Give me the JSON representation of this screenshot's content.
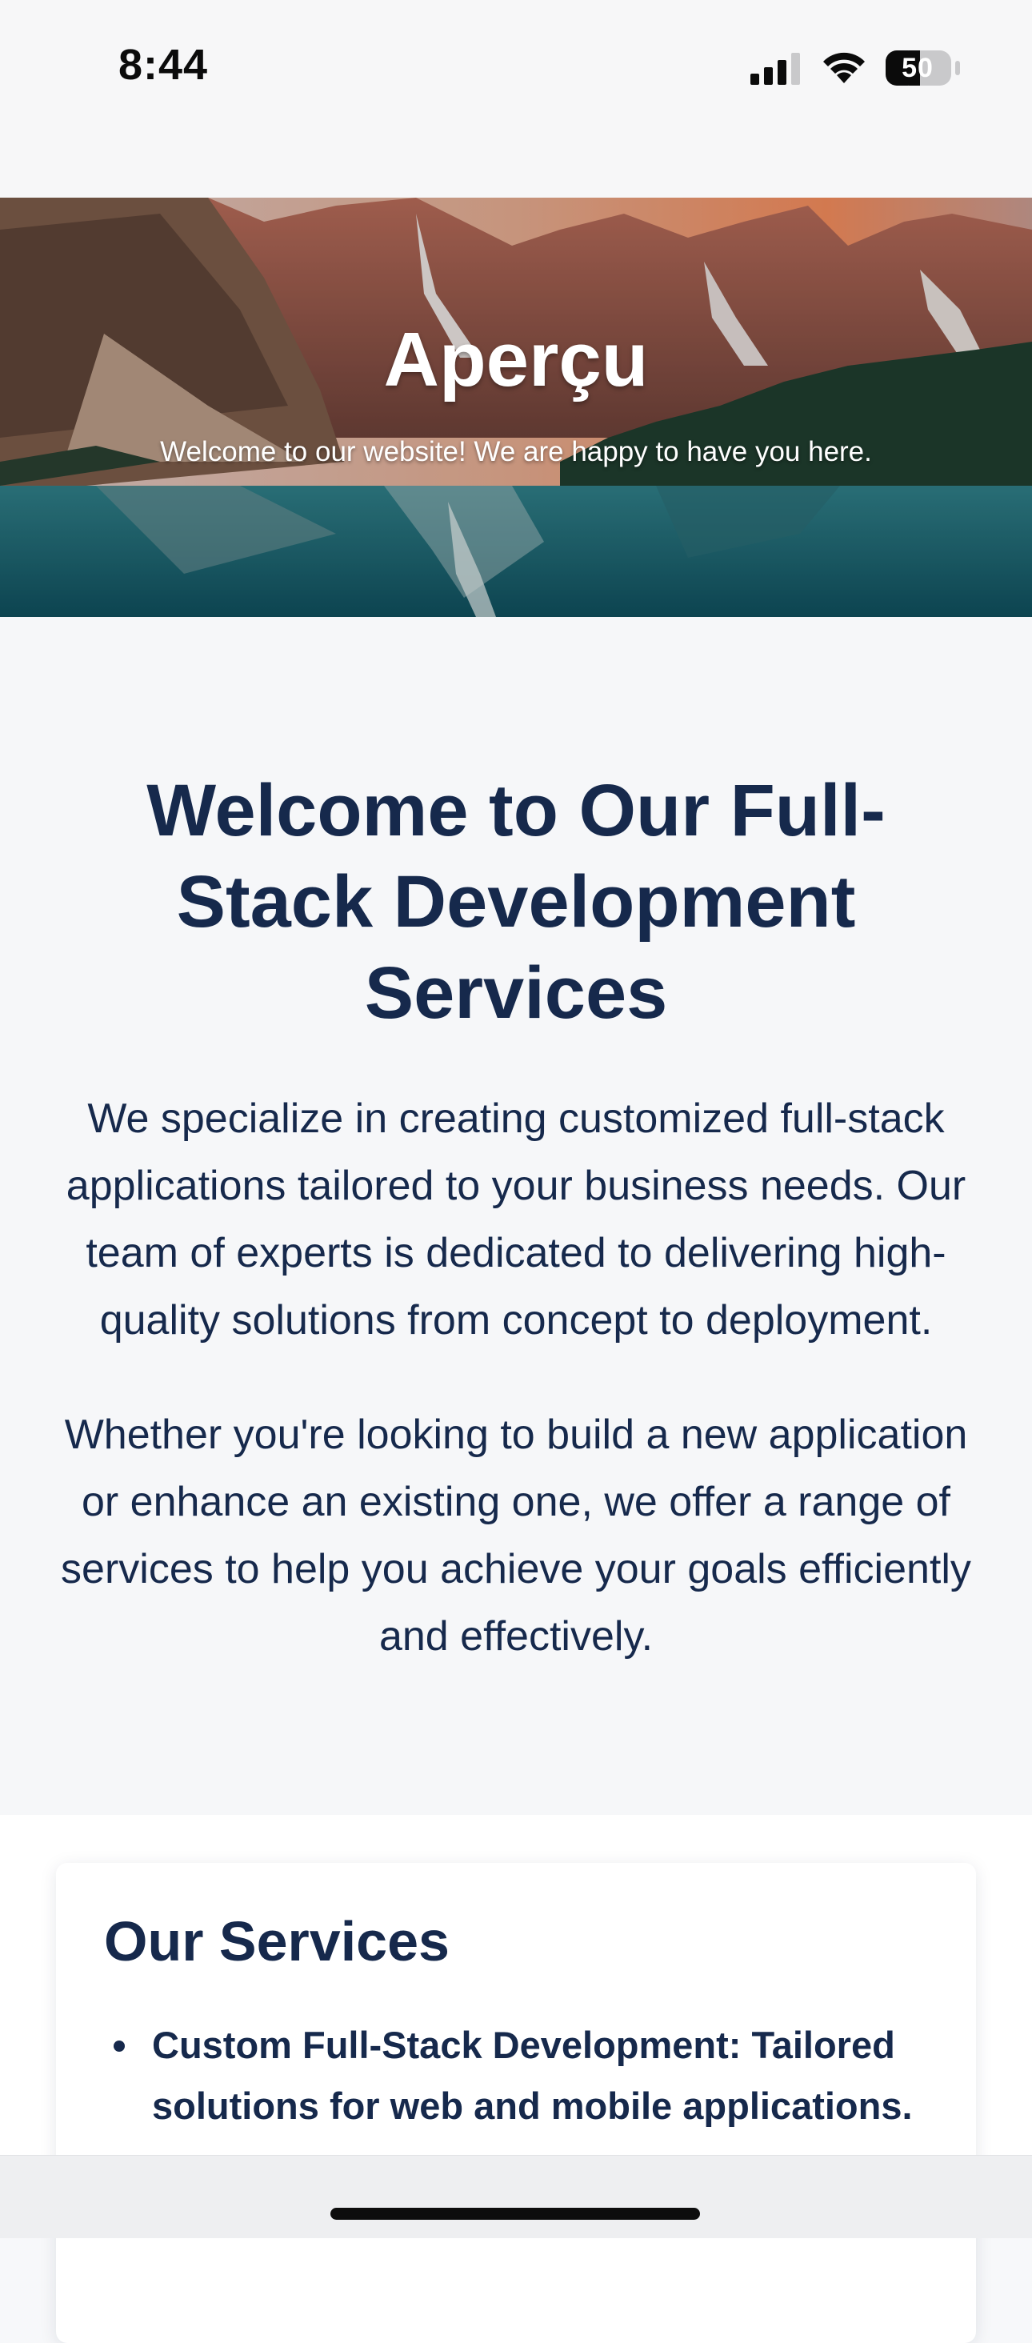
{
  "status_bar": {
    "time": "8:44",
    "battery": "50",
    "icons": [
      "signal-icon",
      "wifi-icon",
      "battery-icon"
    ]
  },
  "hero": {
    "title": "Aperçu",
    "subtitle": "Welcome to our website! We are happy to have you here."
  },
  "intro": {
    "heading": "Welcome to Our Full-Stack Development Services",
    "paragraphs": [
      "We specialize in creating customized full-stack applications tailored to your business needs. Our team of experts is dedicated to delivering high-quality solutions from concept to deployment.",
      "Whether you're looking to build a new application or enhance an existing one, we offer a range of services to help you achieve your goals efficiently and effectively."
    ]
  },
  "services": {
    "heading": "Our Services",
    "items": [
      "Custom Full-Stack Development: Tailored solutions for web and mobile applications."
    ]
  },
  "colors": {
    "navy_text": "#16294c",
    "page_background": "#f6f7f9",
    "card_background": "#ffffff"
  }
}
